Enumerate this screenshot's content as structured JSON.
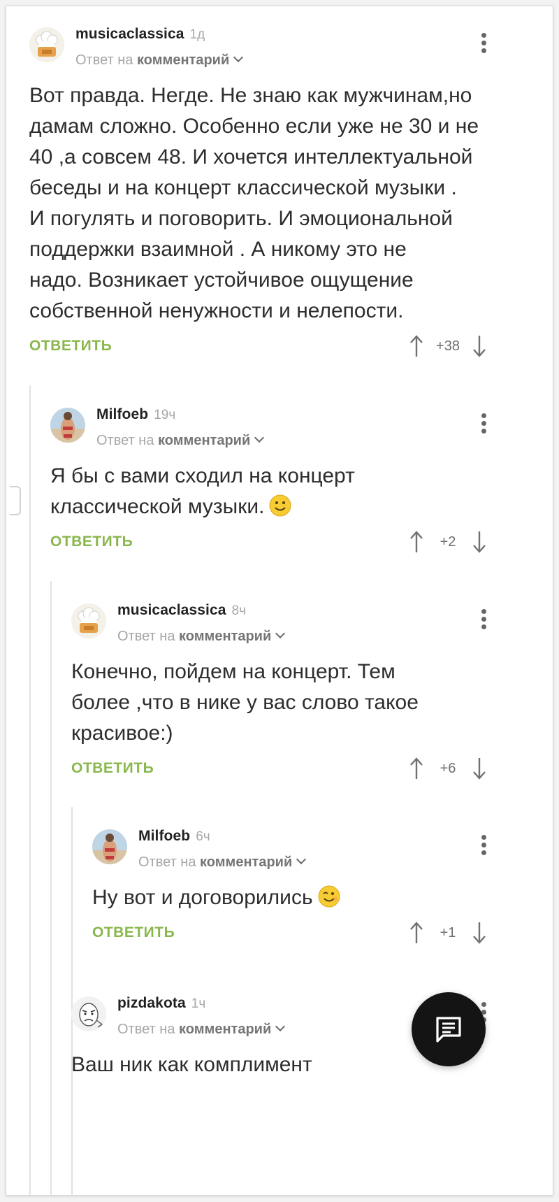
{
  "colors": {
    "accent_green": "#8ab74d",
    "text": "#2d2d2d",
    "meta_gray": "#a6a6a6",
    "fab_bg": "#141414"
  },
  "comments": [
    {
      "username": "musicaclassica",
      "time": "1д",
      "reply_prefix": "Ответ на",
      "reply_target": "комментарий",
      "body": "Вот правда. Негде. Не знаю как мужчинам,но\nдамам сложно. Особенно если уже не 30 и не\n40 ,а совсем 48. И хочется интеллектуальной\nбеседы и на концерт классической музыки .\nИ погулять и поговорить. И  эмоциональной\nподдержки взаимной . А никому это не\nнадо. Возникает устойчивое ощущение\nсобственной  ненужности и нелепости.",
      "reply_label": "ОТВЕТИТЬ",
      "score": "+38",
      "avatar_icon": "chef-hat-avatar-icon"
    },
    {
      "username": "Milfoeb",
      "time": "19ч",
      "reply_prefix": "Ответ на",
      "reply_target": "комментарий",
      "body": "Я бы с вами сходил на концерт\nклассической музыки.",
      "emoji": "smile-emoji-icon",
      "reply_label": "ОТВЕТИТЬ",
      "score": "+2",
      "avatar_icon": "beach-photo-avatar-icon"
    },
    {
      "username": "musicaclassica",
      "time": "8ч",
      "reply_prefix": "Ответ на",
      "reply_target": "комментарий",
      "body": "Конечно, пойдем на концерт. Тем\nболее ,что в нике у вас слово такое\nкрасивое:)",
      "reply_label": "ОТВЕТИТЬ",
      "score": "+6",
      "avatar_icon": "chef-hat-avatar-icon"
    },
    {
      "username": "Milfoeb",
      "time": "6ч",
      "reply_prefix": "Ответ на",
      "reply_target": "комментарий",
      "body": "Ну вот и договорились",
      "emoji": "wink-emoji-icon",
      "reply_label": "ОТВЕТИТЬ",
      "score": "+1",
      "avatar_icon": "beach-photo-avatar-icon"
    },
    {
      "username": "pizdakota",
      "time": "1ч",
      "reply_prefix": "Ответ на",
      "reply_target": "комментарий",
      "body": "Ваш ник как комплимент",
      "avatar_icon": "meme-face-avatar-icon"
    }
  ],
  "icons": {
    "menu": "more-vertical-icon",
    "upvote": "arrow-up-icon",
    "downvote": "arrow-down-icon",
    "fab": "comment-compose-icon"
  }
}
